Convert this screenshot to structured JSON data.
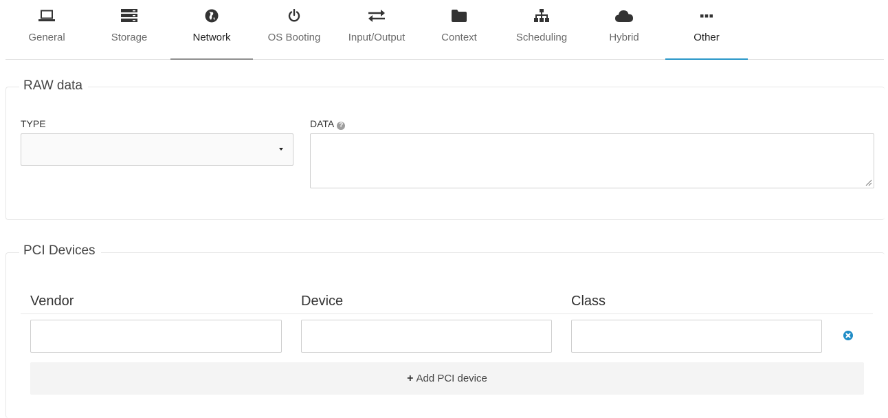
{
  "tabs": [
    {
      "label": "General",
      "icon": "laptop-icon"
    },
    {
      "label": "Storage",
      "icon": "server-icon"
    },
    {
      "label": "Network",
      "icon": "globe-icon"
    },
    {
      "label": "OS Booting",
      "icon": "power-icon"
    },
    {
      "label": "Input/Output",
      "icon": "exchange-icon"
    },
    {
      "label": "Context",
      "icon": "folder-icon"
    },
    {
      "label": "Scheduling",
      "icon": "sitemap-icon"
    },
    {
      "label": "Hybrid",
      "icon": "cloud-icon"
    },
    {
      "label": "Other",
      "icon": "ellipsis-icon"
    }
  ],
  "active_tab": "Other",
  "raw_data": {
    "legend": "RAW data",
    "type_label": "TYPE",
    "type_value": "",
    "data_label": "DATA",
    "data_value": ""
  },
  "pci": {
    "legend": "PCI Devices",
    "columns": [
      "Vendor",
      "Device",
      "Class"
    ],
    "rows": [
      {
        "vendor": "",
        "device": "",
        "class": ""
      }
    ],
    "add_label": "Add PCI device"
  },
  "colors": {
    "accent": "#2a97c9",
    "remove": "#1f8cc6"
  }
}
